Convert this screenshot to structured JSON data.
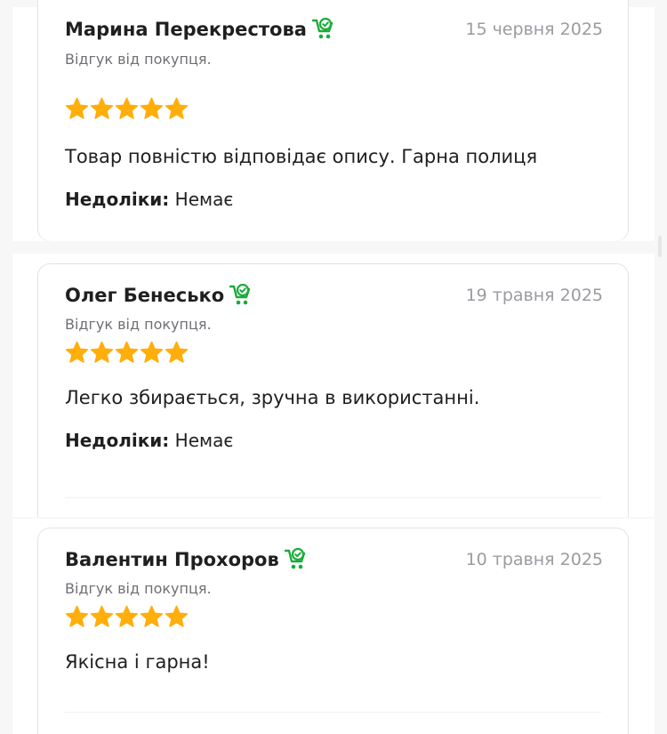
{
  "colors": {
    "star": "#ffae0b",
    "verified": "#1aab3a",
    "date": "#9b9ba1",
    "border": "#e3e3e6"
  },
  "icons": {
    "verified_purchase": "cart-check-icon",
    "rating_star": "star-icon"
  },
  "reviews": [
    {
      "author": "Марина Перекрестова",
      "date": "15 червня 2025",
      "badge": "Відгук від покупця.",
      "rating": 5,
      "rating_max": 5,
      "text": "Товар повністю відповідає опису. Гарна полиця",
      "cons_label": "Недоліки:",
      "cons_value": "Немає"
    },
    {
      "author": "Олег Бенесько",
      "date": "19 травня 2025",
      "badge": "Відгук від покупця.",
      "rating": 5,
      "rating_max": 5,
      "text": "Легко збирається, зручна в використанні.",
      "cons_label": "Недоліки:",
      "cons_value": "Немає"
    },
    {
      "author": "Валентин Прохоров",
      "date": "10 травня 2025",
      "badge": "Відгук від покупця.",
      "rating": 5,
      "rating_max": 5,
      "text": "Якісна і гарна!"
    }
  ]
}
